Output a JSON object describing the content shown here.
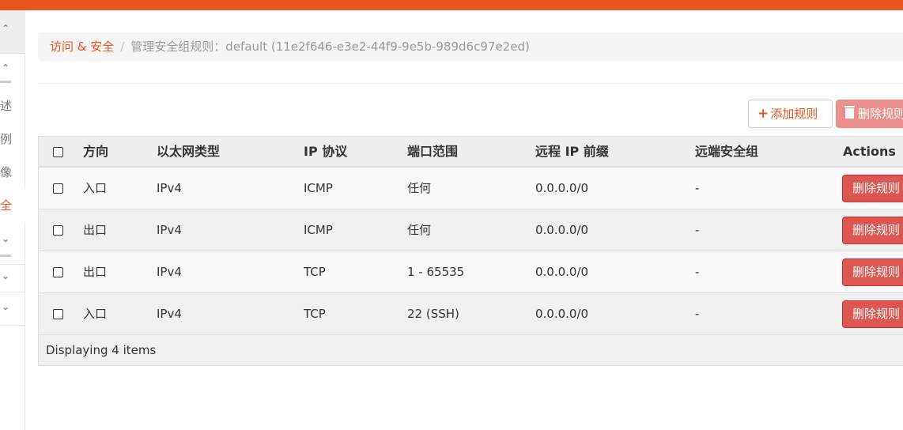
{
  "sidebar": {
    "items": [
      {
        "label": "述",
        "active": false
      },
      {
        "label": "例",
        "active": false
      },
      {
        "label": "像",
        "active": false
      },
      {
        "label": "全",
        "active": true
      }
    ],
    "chevrons": [
      "⌃",
      "⌃",
      "⌄",
      "⌄",
      "⌄"
    ]
  },
  "breadcrumb": {
    "link": "访问 & 安全",
    "separator": "/",
    "current": "管理安全组规则：default (11e2f646-e3e2-44f9-9e5b-989d6c97e2ed)"
  },
  "toolbar": {
    "add_label": "添加规则",
    "delete_label": "删除规则"
  },
  "table": {
    "headers": {
      "direction": "方向",
      "ether_type": "以太网类型",
      "ip_protocol": "IP 协议",
      "port_range": "端口范围",
      "remote_prefix": "远程 IP 前缀",
      "remote_group": "远端安全组",
      "actions": "Actions"
    },
    "rows": [
      {
        "direction": "入口",
        "ether_type": "IPv4",
        "ip_protocol": "ICMP",
        "port_range": "任何",
        "remote_prefix": "0.0.0.0/0",
        "remote_group": "-",
        "action": "删除规则"
      },
      {
        "direction": "出口",
        "ether_type": "IPv4",
        "ip_protocol": "ICMP",
        "port_range": "任何",
        "remote_prefix": "0.0.0.0/0",
        "remote_group": "-",
        "action": "删除规则"
      },
      {
        "direction": "出口",
        "ether_type": "IPv4",
        "ip_protocol": "TCP",
        "port_range": "1 - 65535",
        "remote_prefix": "0.0.0.0/0",
        "remote_group": "-",
        "action": "删除规则"
      },
      {
        "direction": "入口",
        "ether_type": "IPv4",
        "ip_protocol": "TCP",
        "port_range": "22 (SSH)",
        "remote_prefix": "0.0.0.0/0",
        "remote_group": "-",
        "action": "删除规则"
      }
    ],
    "footer": "Displaying 4 items"
  },
  "colors": {
    "brand": "#e95420",
    "danger": "#dd5651",
    "danger_disabled": "#eb8f8d"
  }
}
